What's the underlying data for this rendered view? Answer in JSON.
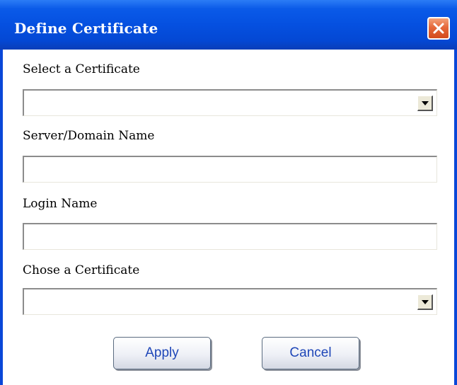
{
  "dialog": {
    "title": "Define Certificate",
    "close_icon": "close-icon"
  },
  "form": {
    "select_certificate_label": "Select a Certificate",
    "select_certificate_value": "",
    "server_domain_label": "Server/Domain Name",
    "server_domain_value": "",
    "login_name_label": "Login Name",
    "login_name_value": "",
    "chose_certificate_label": "Chose a Certificate",
    "chose_certificate_value": ""
  },
  "buttons": {
    "apply_label": "Apply",
    "cancel_label": "Cancel"
  },
  "colors": {
    "title_bar": "#0550e0",
    "close_button": "#e5683a",
    "button_text": "#1f47b8"
  }
}
